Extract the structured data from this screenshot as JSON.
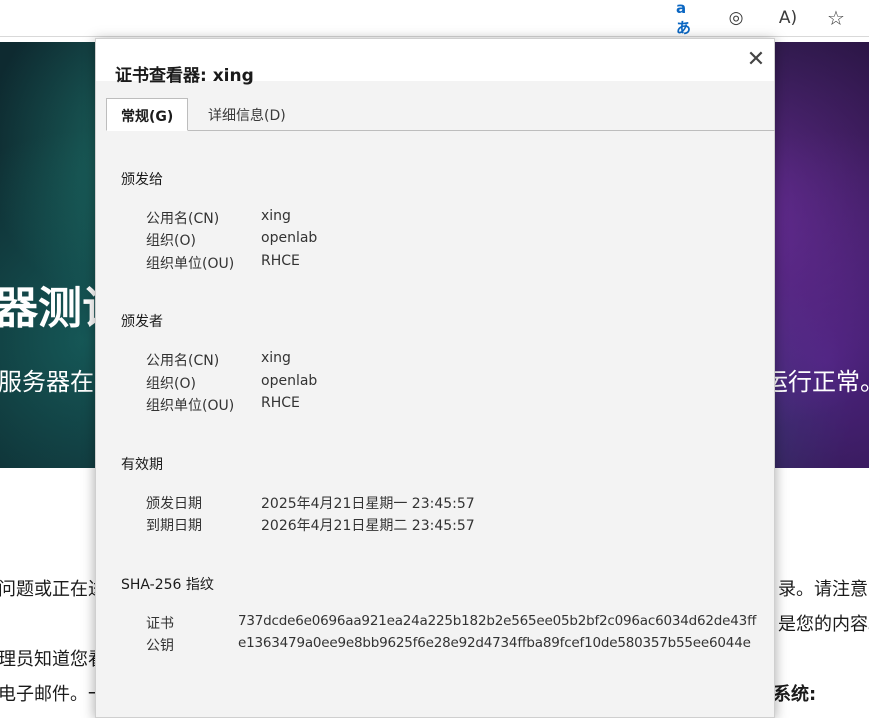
{
  "browser": {
    "icons": [
      "immersive-reader-icon",
      "edge-icon",
      "read-aloud-icon",
      "favorite-star-icon"
    ],
    "read_glyph": "aあ",
    "aloud_glyph": "A)",
    "star_glyph": "☆",
    "edge_glyph": "◎"
  },
  "background": {
    "hero_title": "器测试",
    "hero_sub_left": "服务器在安",
    "hero_sub_right": "运行正常。",
    "line1_left": "问题或正在进",
    "line1_right": "录。请注意",
    "line2_right": "是您的内容。",
    "line3_left": "理员知道您看",
    "line4_left": "电子邮件。一",
    "line4_right": "系统:",
    "accent_colors": [
      "#10323a",
      "#2a1544"
    ]
  },
  "dialog": {
    "title": "证书查看器: xing",
    "close_glyph": "✕",
    "tabs": [
      {
        "label": "常规(G)",
        "selected": true
      },
      {
        "label": "详细信息(D)",
        "selected": false
      }
    ],
    "issued_to": {
      "heading": "颁发给",
      "rows": [
        {
          "label": "公用名(CN)",
          "value": "xing"
        },
        {
          "label": "组织(O)",
          "value": "openlab"
        },
        {
          "label": "组织单位(OU)",
          "value": "RHCE"
        }
      ]
    },
    "issued_by": {
      "heading": "颁发者",
      "rows": [
        {
          "label": "公用名(CN)",
          "value": "xing"
        },
        {
          "label": "组织(O)",
          "value": "openlab"
        },
        {
          "label": "组织单位(OU)",
          "value": "RHCE"
        }
      ]
    },
    "validity": {
      "heading": "有效期",
      "rows": [
        {
          "label": "颁发日期",
          "value": "2025年4月21日星期一 23:45:57"
        },
        {
          "label": "到期日期",
          "value": "2026年4月21日星期二 23:45:57"
        }
      ]
    },
    "fingerprints": {
      "heading": "SHA-256 指纹",
      "rows": [
        {
          "label": "证书",
          "value": "737dcde6e0696aa921ea24a225b182b2e565ee05b2bf2c096ac6034d62de43ff"
        },
        {
          "label": "公钥",
          "value": "e1363479a0ee9e8bb9625f6e28e92d4734ffba89fcef10de580357b55ee6044e"
        }
      ]
    }
  }
}
